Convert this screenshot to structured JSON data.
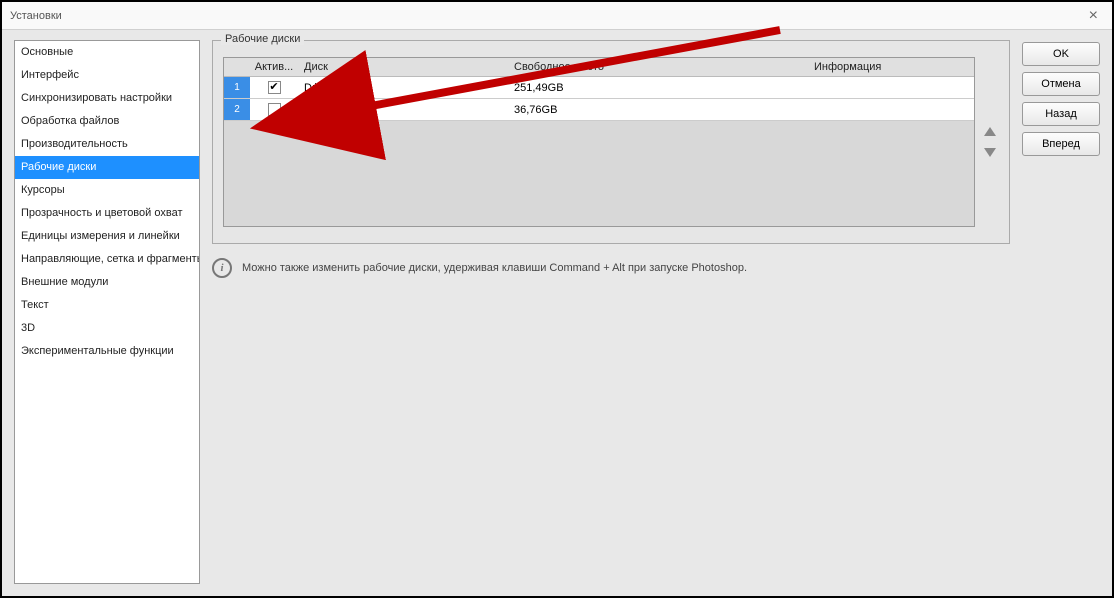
{
  "window": {
    "title": "Установки"
  },
  "sidebar": {
    "items": [
      "Основные",
      "Интерфейс",
      "Синхронизировать настройки",
      "Обработка файлов",
      "Производительность",
      "Рабочие диски",
      "Курсоры",
      "Прозрачность и цветовой охват",
      "Единицы измерения и линейки",
      "Направляющие, сетка и фрагменты",
      "Внешние модули",
      "Текст",
      "3D",
      "Экспериментальные функции"
    ],
    "selectedIndex": 5
  },
  "group": {
    "title": "Рабочие диски",
    "columns": {
      "active": "Актив...",
      "disk": "Диск",
      "free": "Свободное место",
      "info": "Информация"
    },
    "rows": [
      {
        "num": "1",
        "active": true,
        "disk": "D:\\",
        "free": "251,49GB",
        "info": ""
      },
      {
        "num": "2",
        "active": false,
        "disk": "C:\\",
        "free": "36,76GB",
        "info": ""
      }
    ]
  },
  "hint": "Можно также изменить рабочие диски, удерживая клавиши Command + Alt при запуске Photoshop.",
  "buttons": {
    "ok": "OK",
    "cancel": "Отмена",
    "back": "Назад",
    "forward": "Вперед"
  }
}
